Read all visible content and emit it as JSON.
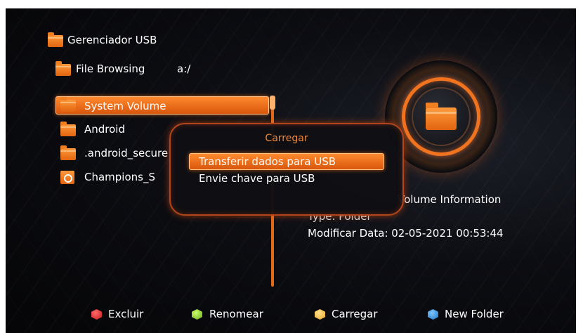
{
  "header": {
    "title": "Gerenciador USB",
    "browse_label": "File Browsing",
    "path": "a:/"
  },
  "file_list": {
    "items": [
      {
        "label": "System Volume",
        "icon": "folder-icon"
      },
      {
        "label": "Android",
        "icon": "folder-icon"
      },
      {
        "label": ".android_secure",
        "icon": "folder-icon"
      },
      {
        "label": "Champions_S",
        "icon": "media-file-icon"
      }
    ]
  },
  "info": {
    "name": "Volume Information",
    "type": "Type: Folder",
    "modified": "Modificar Data: 02-05-2021 00:53:44"
  },
  "dialog": {
    "title": "Carregar",
    "options": [
      "Transferir dados para USB",
      "Envie chave para USB"
    ]
  },
  "footer": {
    "red_label": "Excluir",
    "green_label": "Renomear",
    "yellow_label": "Carregar",
    "blue_label": "New Folder"
  },
  "colors": {
    "accent": "#f07320",
    "selection": "#e8661a",
    "background": "#0a0b0f"
  }
}
